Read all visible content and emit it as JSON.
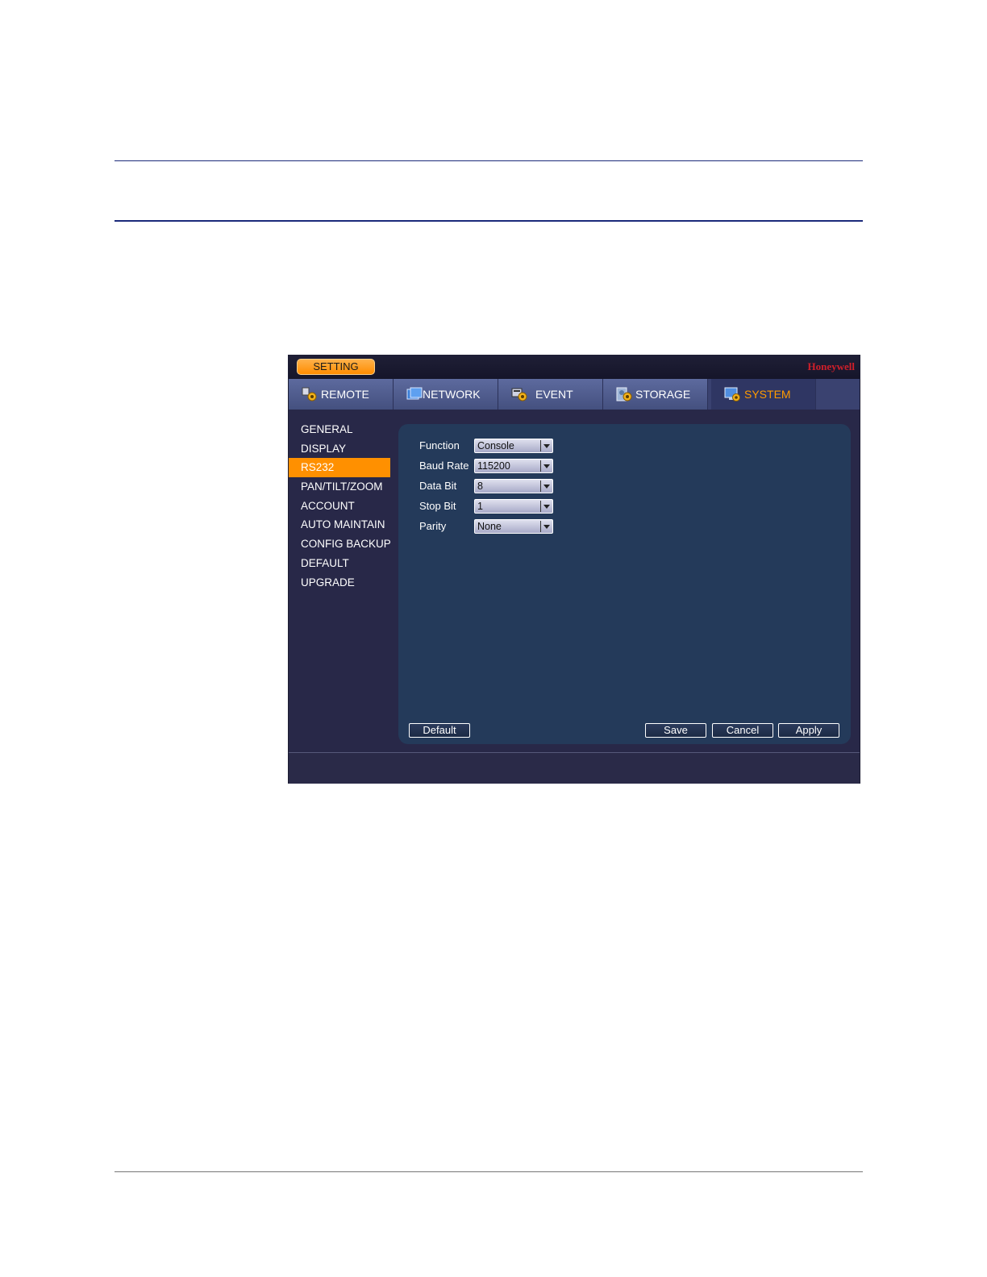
{
  "header": {
    "setting_label": "SETTING",
    "brand": "Honeywell"
  },
  "tabs": [
    {
      "label": "REMOTE",
      "icon": "remote-gear-icon"
    },
    {
      "label": "NETWORK",
      "icon": "network-icon"
    },
    {
      "label": "EVENT",
      "icon": "event-icon"
    },
    {
      "label": "STORAGE",
      "icon": "storage-icon"
    },
    {
      "label": "SYSTEM",
      "icon": "system-icon",
      "active": true
    }
  ],
  "sidebar": {
    "items": [
      {
        "label": "GENERAL"
      },
      {
        "label": "DISPLAY"
      },
      {
        "label": "RS232",
        "active": true
      },
      {
        "label": "PAN/TILT/ZOOM"
      },
      {
        "label": "ACCOUNT"
      },
      {
        "label": "AUTO MAINTAIN"
      },
      {
        "label": "CONFIG BACKUP"
      },
      {
        "label": "DEFAULT"
      },
      {
        "label": "UPGRADE"
      }
    ]
  },
  "form": {
    "fields": [
      {
        "label": "Function",
        "value": "Console"
      },
      {
        "label": "Baud Rate",
        "value": "115200"
      },
      {
        "label": "Data Bit",
        "value": "8"
      },
      {
        "label": "Stop Bit",
        "value": "1"
      },
      {
        "label": "Parity",
        "value": "None"
      }
    ]
  },
  "buttons": {
    "default": "Default",
    "save": "Save",
    "cancel": "Cancel",
    "apply": "Apply"
  },
  "colors": {
    "accent": "#ff9000",
    "panel": "#243a5a",
    "window": "#282848",
    "brand": "#d01f2a"
  }
}
